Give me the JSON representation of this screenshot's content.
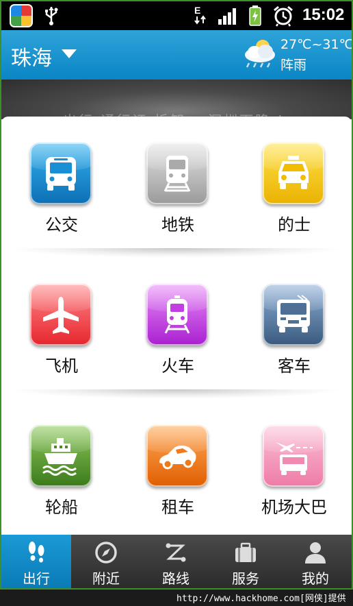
{
  "status_bar": {
    "time": "15:02",
    "icons": [
      "app-icon",
      "usb-icon",
      "data-e-icon",
      "signal-icon",
      "battery-icon",
      "alarm-icon"
    ]
  },
  "header": {
    "city": "珠海",
    "weather": {
      "temp": "27℃~31℃",
      "desc": "阵雨",
      "icon": "cloud-rain-icon"
    }
  },
  "banner": {
    "text": "出行 通行证 拆卸 一深圳下降 !"
  },
  "grid": {
    "items": [
      {
        "label": "公交",
        "icon": "bus-icon",
        "color": "#1a8fd6"
      },
      {
        "label": "地铁",
        "icon": "subway-icon",
        "color": "#a9a9a9"
      },
      {
        "label": "的士",
        "icon": "taxi-icon",
        "color": "#f5c000"
      },
      {
        "label": "飞机",
        "icon": "airplane-icon",
        "color": "#f0474c"
      },
      {
        "label": "火车",
        "icon": "train-icon",
        "color": "#c13fe0"
      },
      {
        "label": "客车",
        "icon": "coach-icon",
        "color": "#4f6f94"
      },
      {
        "label": "轮船",
        "icon": "ship-icon",
        "color": "#4f8a2a"
      },
      {
        "label": "租车",
        "icon": "car-rental-icon",
        "color": "#f07a18"
      },
      {
        "label": "机场大巴",
        "icon": "airport-bus-icon",
        "color": "#f08ab0"
      }
    ]
  },
  "bottom_nav": {
    "items": [
      {
        "label": "出行",
        "icon": "footprints-icon",
        "active": true
      },
      {
        "label": "附近",
        "icon": "compass-icon",
        "active": false
      },
      {
        "label": "路线",
        "icon": "route-icon",
        "active": false
      },
      {
        "label": "服务",
        "icon": "briefcase-icon",
        "active": false
      },
      {
        "label": "我的",
        "icon": "user-icon",
        "active": false
      }
    ]
  },
  "footer": {
    "url": "http://www.hackhome.com[网侠]提供"
  }
}
